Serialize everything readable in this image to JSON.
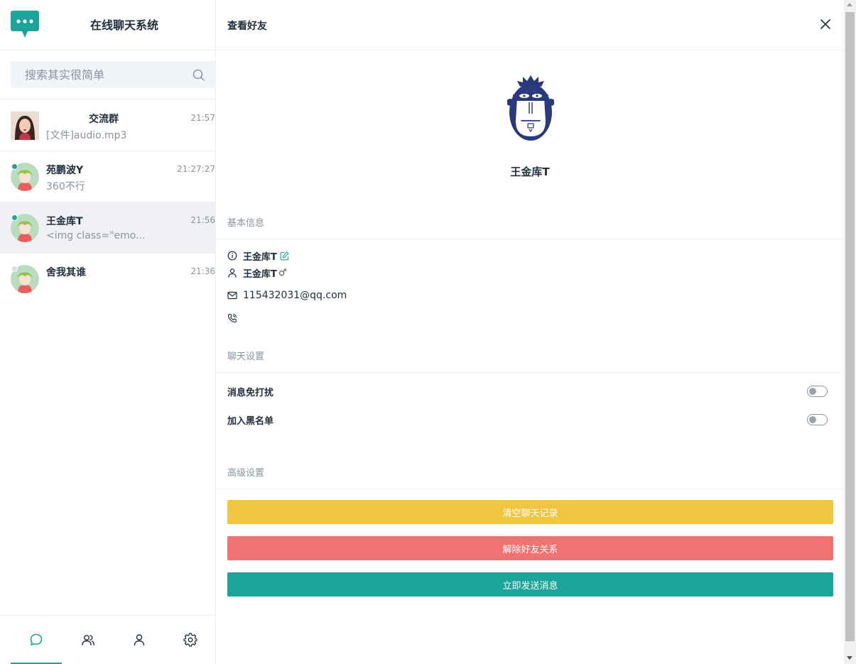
{
  "app": {
    "title": "在线聊天系统"
  },
  "search": {
    "placeholder": "搜索其实很简单"
  },
  "chats": [
    {
      "name": "交流群",
      "time": "21:57",
      "preview": "[文件]audio.mp3",
      "status": "none"
    },
    {
      "name": "苑鹏波Y",
      "time": "21:27:27",
      "preview": "360不行",
      "status": "online"
    },
    {
      "name": "王金库T",
      "time": "21:56",
      "preview": "<img class=\"emo...",
      "status": "online"
    },
    {
      "name": "舍我其谁",
      "time": "21:36",
      "preview": "",
      "status": "offline"
    }
  ],
  "panel": {
    "title": "查看好友",
    "friend_name": "王金库T",
    "basic_section": "基本信息",
    "nickname": "王金库T",
    "username": "王金库T",
    "gender_symbol": "♂",
    "email": "115432031@qq.com",
    "phone": "",
    "chat_section": "聊天设置",
    "mute_label": "消息免打扰",
    "blacklist_label": "加入黑名单",
    "mute_on": false,
    "blacklist_on": false,
    "advanced_section": "高级设置",
    "clear_btn": "清空聊天记录",
    "unfriend_btn": "解除好友关系",
    "send_btn": "立即发送消息"
  },
  "colors": {
    "accent": "#1ba39c",
    "warning": "#f0c53f",
    "danger": "#f27171",
    "online": "#1ba39c",
    "offline": "#d9dde2"
  },
  "icons": {
    "nav": [
      "chat-bubble-icon",
      "contacts-icon",
      "user-icon",
      "gear-icon"
    ],
    "info": [
      "info-circle-icon",
      "user-icon",
      "mail-icon",
      "phone-icon",
      "edit-icon"
    ]
  }
}
